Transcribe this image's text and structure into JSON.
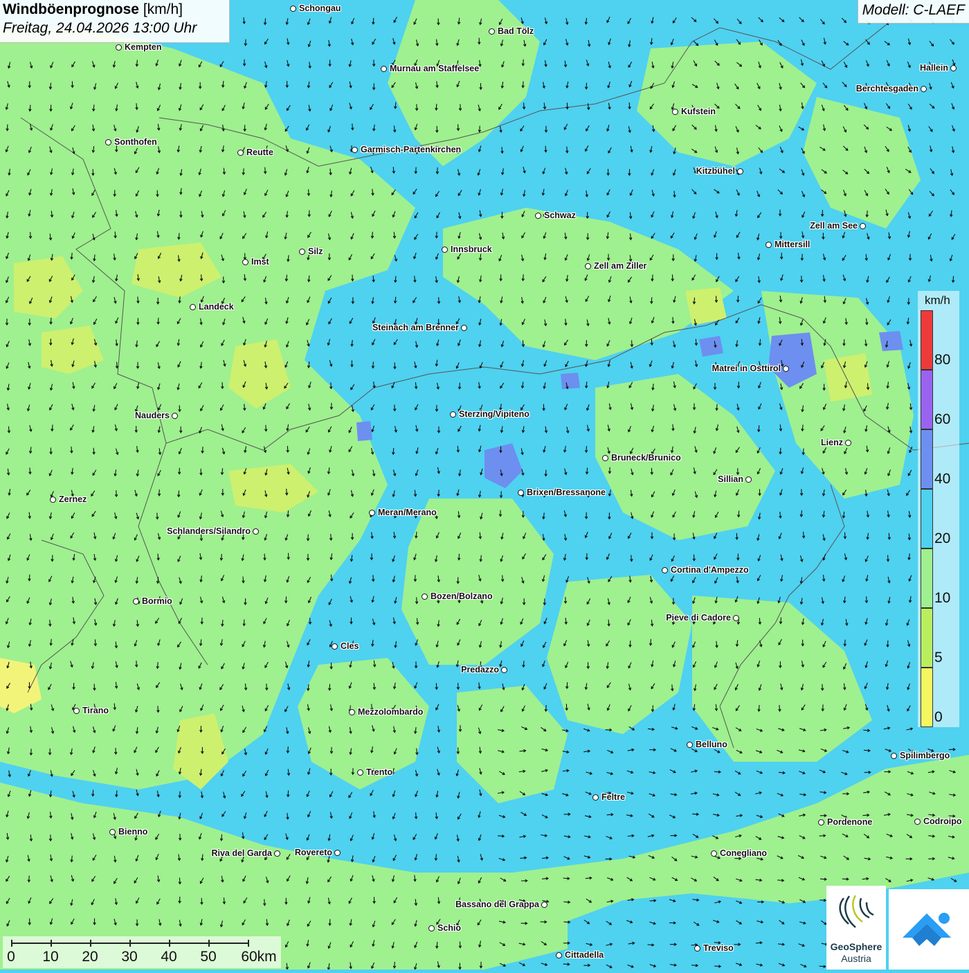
{
  "header": {
    "title_bold": "Windböenprognose",
    "title_unit": "[km/h]",
    "date": "Freitag, 24.04.2026 13:00 Uhr",
    "model": "Modell: C-LAEF"
  },
  "legend": {
    "unit": "km/h",
    "ticks": [
      "0",
      "5",
      "10",
      "20",
      "40",
      "60",
      "80"
    ],
    "colors": [
      "#f5f760",
      "#b9ef5f",
      "#9ff08f",
      "#4fd1f0",
      "#6d8ff0",
      "#9a63ef",
      "#ef3a3a"
    ]
  },
  "scalebar": {
    "labels": [
      "0",
      "10",
      "20",
      "30",
      "40",
      "50",
      "60km"
    ]
  },
  "logos": {
    "geosphere_line1": "GeoSphere",
    "geosphere_line2": "Austria"
  },
  "cities": [
    {
      "name": "Schongau"
    },
    {
      "name": "Bad Tölz"
    },
    {
      "name": "Kempten"
    },
    {
      "name": "Hallein"
    },
    {
      "name": "Murnau am Staffelsee"
    },
    {
      "name": "Berchtesgaden"
    },
    {
      "name": "Kufstein"
    },
    {
      "name": "Sonthofen"
    },
    {
      "name": "Reutte"
    },
    {
      "name": "Garmisch-Partenkirchen"
    },
    {
      "name": "Kitzbühel"
    },
    {
      "name": "Schwaz"
    },
    {
      "name": "Zell am See"
    },
    {
      "name": "Mittersill"
    },
    {
      "name": "Silz"
    },
    {
      "name": "Innsbruck"
    },
    {
      "name": "Imst"
    },
    {
      "name": "Zell am Ziller"
    },
    {
      "name": "Landeck"
    },
    {
      "name": "Steinach am Brenner"
    },
    {
      "name": "Matrei in Osttirol"
    },
    {
      "name": "Nauders"
    },
    {
      "name": "Sterzing/Vipiteno"
    },
    {
      "name": "Lienz"
    },
    {
      "name": "Bruneck/Brunico"
    },
    {
      "name": "Sillian"
    },
    {
      "name": "Brixen/Bressanone"
    },
    {
      "name": "Zernez"
    },
    {
      "name": "Meran/Merano"
    },
    {
      "name": "Schlanders/Silandro"
    },
    {
      "name": "Cortina d'Ampezzo"
    },
    {
      "name": "Bozen/Bolzano"
    },
    {
      "name": "Bormio"
    },
    {
      "name": "Pieve di Cadore"
    },
    {
      "name": "Cles"
    },
    {
      "name": "Predazzo"
    },
    {
      "name": "Tirano"
    },
    {
      "name": "Mezzolombardo"
    },
    {
      "name": "Belluno"
    },
    {
      "name": "Spilimbergo"
    },
    {
      "name": "Trento"
    },
    {
      "name": "Feltre"
    },
    {
      "name": "Pordenone"
    },
    {
      "name": "Codroipo"
    },
    {
      "name": "Bienno"
    },
    {
      "name": "Riva del Garda"
    },
    {
      "name": "Rovereto"
    },
    {
      "name": "Conegliano"
    },
    {
      "name": "Bassano del Grappa"
    },
    {
      "name": "Schio"
    },
    {
      "name": "Treviso"
    },
    {
      "name": "Cittadella"
    }
  ]
}
